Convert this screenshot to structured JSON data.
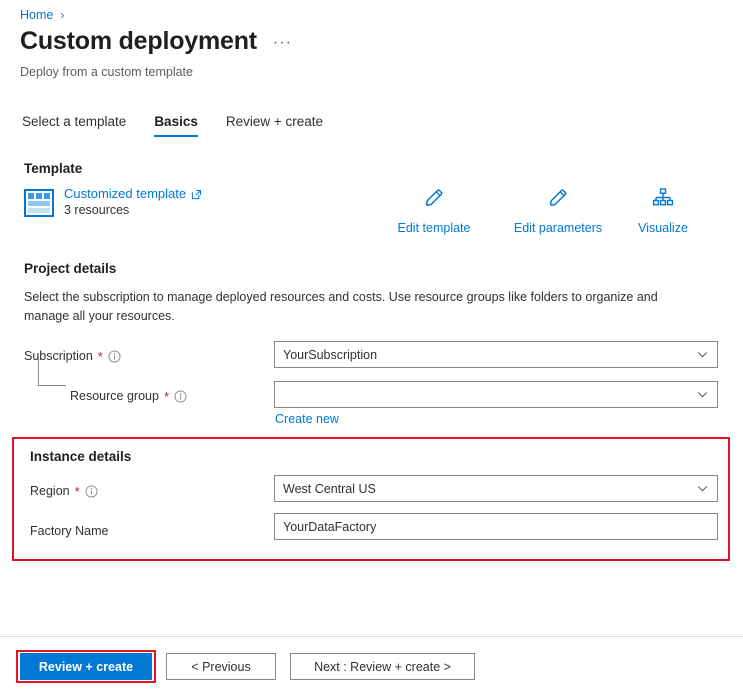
{
  "breadcrumb": {
    "home": "Home",
    "separator": "›"
  },
  "header": {
    "title": "Custom deployment",
    "ellipsis": "···",
    "subtitle": "Deploy from a custom template"
  },
  "tabs": [
    {
      "label": "Select a template",
      "active": false
    },
    {
      "label": "Basics",
      "active": true
    },
    {
      "label": "Review + create",
      "active": false
    }
  ],
  "template": {
    "heading": "Template",
    "link_label": "Customized template",
    "resource_count": "3 resources",
    "actions": [
      {
        "label": "Edit template",
        "icon": "pencil-icon"
      },
      {
        "label": "Edit parameters",
        "icon": "pencil-icon"
      },
      {
        "label": "Visualize",
        "icon": "hierarchy-icon"
      }
    ]
  },
  "project_details": {
    "heading": "Project details",
    "description": "Select the subscription to manage deployed resources and costs. Use resource groups like folders to organize and manage all your resources.",
    "subscription": {
      "label": "Subscription",
      "required": "*",
      "value": "YourSubscription"
    },
    "resource_group": {
      "label": "Resource group",
      "required": "*",
      "value": "",
      "create_new": "Create new"
    }
  },
  "instance_details": {
    "heading": "Instance details",
    "region": {
      "label": "Region",
      "required": "*",
      "value": "West Central US"
    },
    "factory_name": {
      "label": "Factory Name",
      "value": "YourDataFactory"
    }
  },
  "footer": {
    "review_create": "Review + create",
    "previous": "< Previous",
    "next": "Next : Review + create >"
  },
  "colors": {
    "accent": "#0078d4",
    "highlight": "#e81123",
    "required": "#a4262c",
    "border": "#8a8886"
  }
}
